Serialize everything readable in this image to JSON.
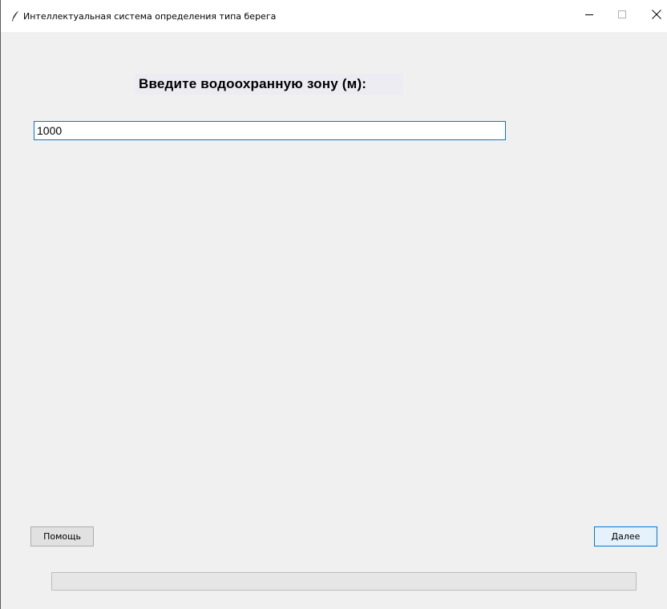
{
  "window": {
    "title": "Интеллектуальная система определения типа берега",
    "icon": "feather-icon",
    "controls": {
      "minimize": "minimize-icon",
      "maximize": "maximize-icon",
      "close": "close-icon"
    }
  },
  "form": {
    "heading": "Введите водоохранную зону (м):",
    "input_value": "1000"
  },
  "buttons": {
    "help_label": "Помощь",
    "next_label": "Далее"
  },
  "progress": {
    "value": 0
  },
  "colors": {
    "accent": "#0078d7",
    "background": "#f0f0f0"
  }
}
